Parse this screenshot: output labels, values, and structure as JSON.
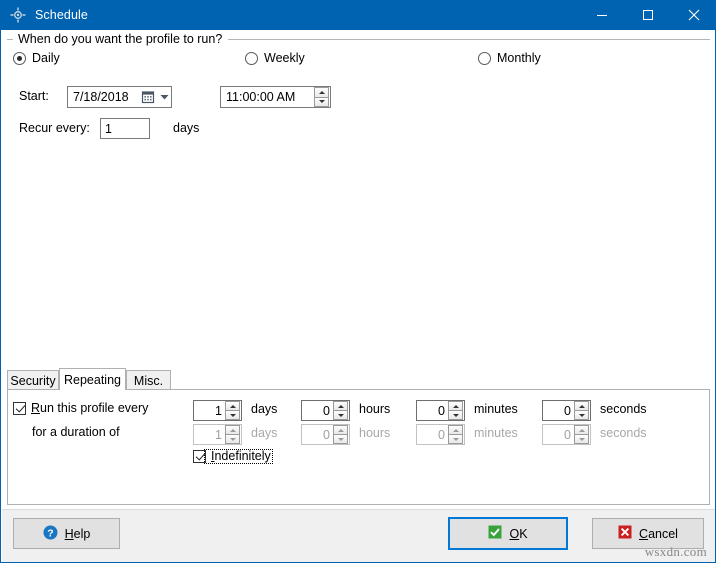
{
  "window": {
    "title": "Schedule",
    "icon": "schedule-icon",
    "titlebar_color": "#0063b1",
    "controls": [
      {
        "name": "minimize",
        "glyph": "minimize-icon"
      },
      {
        "name": "maximize",
        "glyph": "maximize-icon"
      },
      {
        "name": "close",
        "glyph": "close-icon"
      }
    ]
  },
  "groupbox": {
    "caption": "When do you want the profile to run?"
  },
  "frequency": {
    "selected": "Daily",
    "options": [
      {
        "label": "Daily",
        "checked": true
      },
      {
        "label": "Weekly",
        "checked": false
      },
      {
        "label": "Monthly",
        "checked": false
      }
    ]
  },
  "start": {
    "label": "Start:",
    "date_value": "7/18/2018",
    "date_icon": "calendar-icon",
    "date_dropdown_icon": "chevron-down-icon",
    "time_value": "11:00:00 AM"
  },
  "recur": {
    "label": "Recur every:",
    "value": "1",
    "unit": "days"
  },
  "tabs": [
    {
      "label": "Security",
      "selected": false
    },
    {
      "label": "Repeating",
      "selected": true
    },
    {
      "label": "Misc.",
      "selected": false
    }
  ],
  "repeating": {
    "run_every": {
      "label": "Run this profile every",
      "accelerator": "R",
      "checked": true
    },
    "duration": {
      "label": "for a duration of"
    },
    "indefinitely": {
      "label": "Indefinitely",
      "accelerator": "I",
      "checked": true,
      "focused": true
    },
    "row_every": {
      "days": "1",
      "hours": "0",
      "minutes": "0",
      "seconds": "0"
    },
    "row_duration": {
      "days": "1",
      "hours": "0",
      "minutes": "0",
      "seconds": "0",
      "disabled": true
    },
    "units": {
      "days": "days",
      "hours": "hours",
      "minutes": "minutes",
      "seconds": "seconds"
    }
  },
  "footer": {
    "help": {
      "label": "Help",
      "accelerator": "H",
      "icon": "question-mark-icon",
      "icon_color": "#1a75c2"
    },
    "ok": {
      "label": "OK",
      "accelerator": "O",
      "icon": "green-check-icon",
      "icon_color": "#3ba23b",
      "focused": true
    },
    "cancel": {
      "label": "Cancel",
      "accelerator": "C",
      "icon": "red-x-icon",
      "icon_color": "#cc1f1f"
    }
  },
  "watermark": "wsxdn.com"
}
